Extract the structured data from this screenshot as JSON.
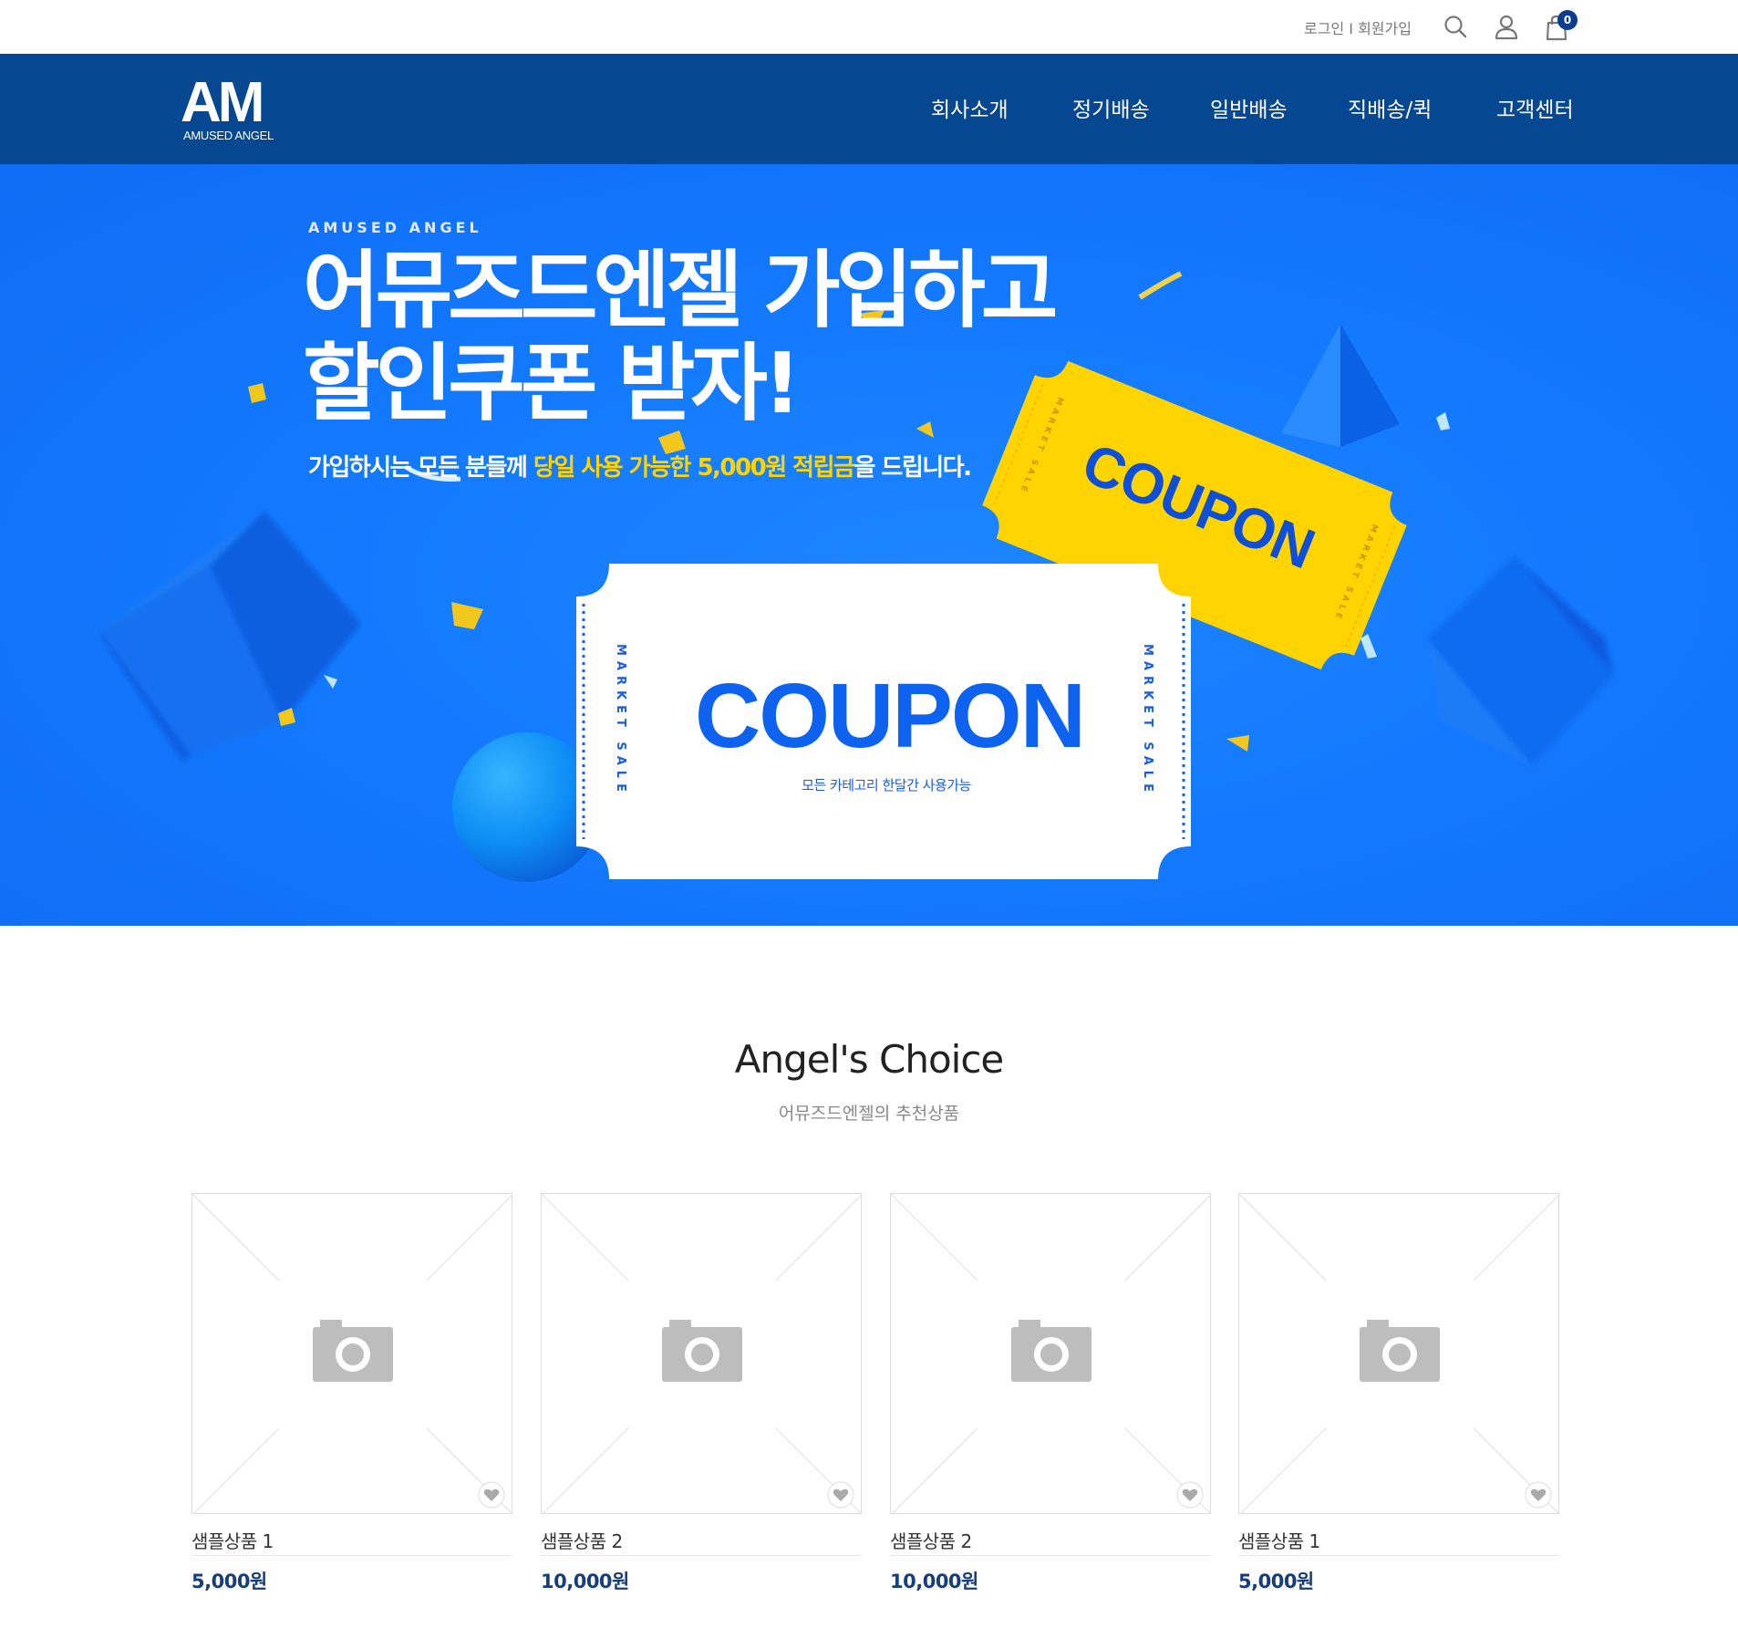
{
  "topbar": {
    "login_label": "로그인",
    "separator": "I",
    "signup_label": "회원가입",
    "search_icon": "search-icon",
    "user_icon": "user-icon",
    "cart_icon": "shopping-bag-icon",
    "cart_count": "0"
  },
  "header": {
    "logo_main": "AM",
    "logo_sub": "AMUSED ANGEL",
    "nav": [
      "회사소개",
      "정기배송",
      "일반배송",
      "직배송/퀵",
      "고객센터"
    ]
  },
  "hero": {
    "brand": "AMUSED ANGEL",
    "headline_line1": "어뮤즈드엔젤 가입하고",
    "headline_line2": "할인쿠폰 받자!",
    "subline_pre": "가입하시는 모든 분들께 ",
    "subline_highlight": "당일 사용 가능한 5,000원 적립금",
    "subline_post": "을 드립니다.",
    "coupon_title": "COUPON",
    "coupon_desc": "모든 카테고리 한달간 사용가능",
    "coupon_side_text": "MARKET SALE",
    "coupon2_title": "COUPON",
    "colors": {
      "background": "#137aff",
      "highlight": "#ffd400",
      "coupon_yellow": "#ffd400"
    }
  },
  "section": {
    "title": "Angel's Choice",
    "subtitle": "어뮤즈드엔젤의 추천상품"
  },
  "products": [
    {
      "name": "샘플상품 1",
      "price": "5,000원"
    },
    {
      "name": "샘플상품 2",
      "price": "10,000원"
    },
    {
      "name": "샘플상품 2",
      "price": "10,000원"
    },
    {
      "name": "샘플상품 1",
      "price": "5,000원"
    }
  ]
}
